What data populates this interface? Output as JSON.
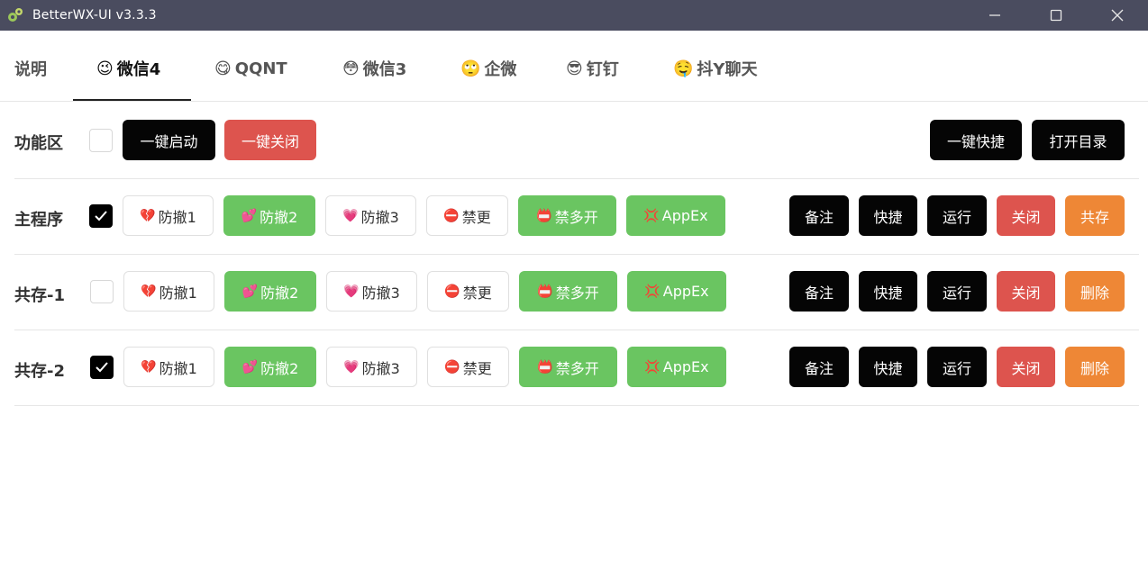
{
  "window": {
    "title": "BetterWX-UI v3.3.3",
    "icon": "gears-icon"
  },
  "tabs": [
    {
      "label": "说明",
      "emoji": ""
    },
    {
      "label": "微信4",
      "emoji": "😉"
    },
    {
      "label": "QQNT",
      "emoji": "😋"
    },
    {
      "label": "微信3",
      "emoji": "😳"
    },
    {
      "label": "企微",
      "emoji": "🙄"
    },
    {
      "label": "钉钉",
      "emoji": "😎"
    },
    {
      "label": "抖Y聊天",
      "emoji": "🤤"
    }
  ],
  "active_tab": "微信4",
  "function_area": {
    "label": "功能区",
    "checked": false,
    "start_all": "一键启动",
    "close_all": "一键关闭",
    "shortcut_all": "一键快捷",
    "open_dir": "打开目录"
  },
  "feature_buttons": {
    "antirecall1": {
      "label": "防撤1",
      "icon": "💔"
    },
    "antirecall2": {
      "label": "防撤2",
      "icon": "💕"
    },
    "antirecall3": {
      "label": "防撤3",
      "icon": "💗"
    },
    "noupdate": {
      "label": "禁更",
      "icon": "⛔"
    },
    "multiopen": {
      "label": "禁多开",
      "icon": "📛"
    },
    "appex": {
      "label": "AppEx",
      "icon": "💢"
    }
  },
  "action_buttons": {
    "note": "备注",
    "shortcut": "快捷",
    "run": "运行",
    "close": "关闭",
    "coexist": "共存",
    "delete": "删除"
  },
  "rows": [
    {
      "label": "主程序",
      "checked": true,
      "last_action": "共存"
    },
    {
      "label": "共存-1",
      "checked": false,
      "last_action": "删除"
    },
    {
      "label": "共存-2",
      "checked": true,
      "last_action": "删除"
    }
  ],
  "colors": {
    "titlebar": "#4a4c5f",
    "black": "#050505",
    "red": "#dd544e",
    "green": "#6ac561",
    "orange": "#ee8736"
  }
}
